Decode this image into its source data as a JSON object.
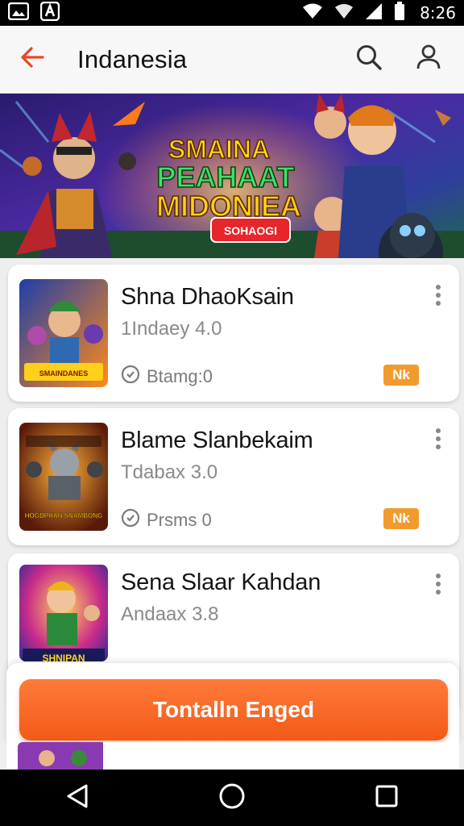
{
  "status_bar": {
    "time": "8:26",
    "icons": [
      "image-icon",
      "app-logo-icon",
      "wifi-icon",
      "signal-icon",
      "battery-icon"
    ]
  },
  "app_bar": {
    "title": "Indanesia",
    "icons": [
      "back-arrow-icon",
      "search-icon",
      "profile-icon"
    ],
    "accent_color": "#e8472a"
  },
  "banner": {
    "title_lines": [
      "SMAINA",
      "PEAHAAT",
      "MIDONIEA"
    ],
    "tag": "SOHAOGI"
  },
  "items": [
    {
      "name": "Shna DhaoKsain",
      "subtitle": "1Indaey 4.0",
      "stat": "Btamg:0",
      "badge": "Nk",
      "thumb_label": "SMAINDANES"
    },
    {
      "name": "Blame Slanbekaim",
      "subtitle": "Tdabax 3.0",
      "stat": "Prsms 0",
      "badge": "Nk",
      "thumb_label": "HOGDPHAN SNAMBONG"
    },
    {
      "name": "Sena Slaar Kahdan",
      "subtitle": "Andaax 3.8",
      "stat": "",
      "badge": "",
      "thumb_label": "SHNIPAN"
    }
  ],
  "cta": {
    "label": "Tontalln Enged"
  },
  "colors": {
    "cta": "#f35a17",
    "badge": "#f39a2d",
    "background": "#eeeeee"
  },
  "nav_bar": {
    "icons": [
      "back-triangle-icon",
      "home-circle-icon",
      "recents-square-icon"
    ]
  }
}
